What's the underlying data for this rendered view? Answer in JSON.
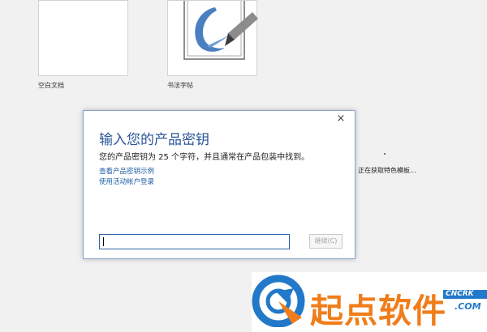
{
  "templates": [
    {
      "label": "空白文档"
    },
    {
      "label": "书法字帖"
    }
  ],
  "status": {
    "loading_text": "正在获取特色模板..."
  },
  "dialog": {
    "close_glyph": "×",
    "title": "输入您的产品密钥",
    "description": "您的产品密钥为 25 个字符，并且通常在产品包装中找到。",
    "link_example": "查看产品密钥示例",
    "link_signin": "使用活动帐户登录",
    "key_value": "",
    "continue_label": "继续(C)"
  },
  "watermark": {
    "brand_cn": "起点软件",
    "brand_bar": "CNCRK",
    "brand_suffix": ".COM"
  },
  "colors": {
    "accent_title": "#2a5597",
    "link": "#1f5fa6",
    "watermark_orange": "#f07d1b",
    "watermark_blue": "#2279c9"
  }
}
